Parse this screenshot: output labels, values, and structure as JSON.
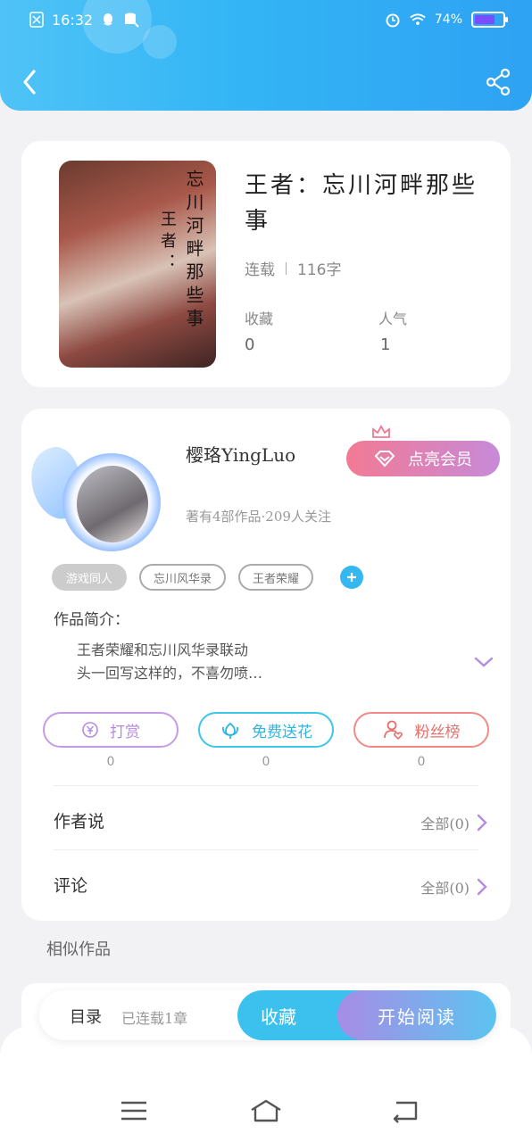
{
  "status_bar": {
    "time": "16:32",
    "battery": "74%",
    "battery_level": 0.74
  },
  "book": {
    "title": "王者：忘川河畔那些事",
    "cover_text_a": "忘川河畔那些事",
    "cover_text_b": "王者：",
    "status": "连载",
    "word_count": "116字",
    "favorites_label": "收藏",
    "favorites_value": "0",
    "popularity_label": "人气",
    "popularity_value": "1"
  },
  "author": {
    "name": "樱珞YingLuo",
    "meta": "著有4部作品·209人关注",
    "vip_label": "点亮会员"
  },
  "tags": [
    {
      "label": "游戏同人"
    },
    {
      "label": "忘川风华录"
    },
    {
      "label": "王者荣耀"
    }
  ],
  "intro": {
    "label": "作品简介：",
    "line1": "王者荣耀和忘川风华录联动",
    "line2": "头一回写这样的，不喜勿喷…"
  },
  "actions": [
    {
      "label": "打赏",
      "count": "0",
      "color": "#c59be6"
    },
    {
      "label": "免费送花",
      "count": "0",
      "color": "#3cc6e8"
    },
    {
      "label": "粉丝榜",
      "count": "0",
      "color": "#ef8a86"
    }
  ],
  "rows": {
    "author_says_label": "作者说",
    "author_says_right": "全部(0)",
    "comments_label": "评论",
    "comments_right": "全部(0)"
  },
  "similar_label": "相似作品",
  "bottom_bar": {
    "toc_label": "目录",
    "toc_sub": "已连载1章",
    "favorite_label": "收藏",
    "read_label": "开始阅读"
  },
  "colors": {
    "header": "#33b5f5",
    "accent_purple": "#b48be0",
    "vip": "#f27a94"
  }
}
